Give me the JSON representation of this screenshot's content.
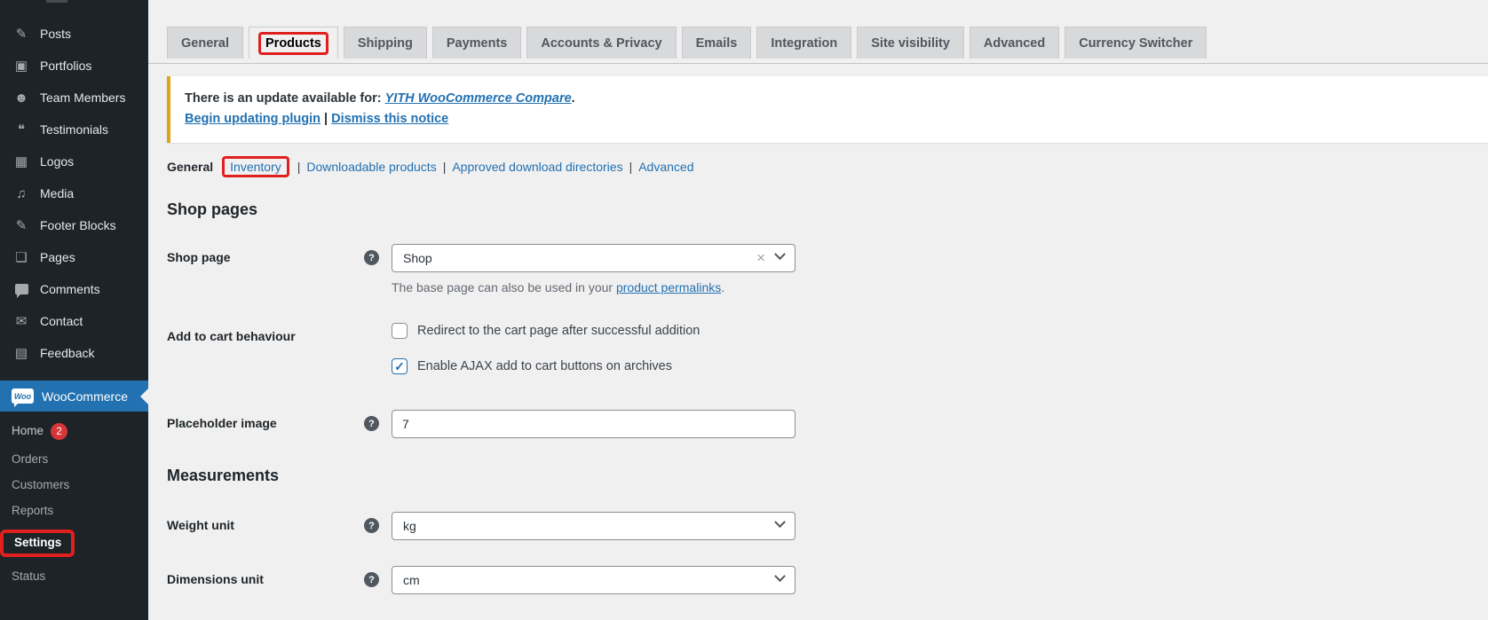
{
  "colors": {
    "accent_blue": "#2271b1",
    "sidebar_bg": "#1d2327",
    "content_bg": "#f0f0f1",
    "notice_accent": "#dba617",
    "badge_red": "#d63638",
    "annotation_red": "#e0201f"
  },
  "sidebar": {
    "items": [
      {
        "label": "Posts",
        "glyph": "✎"
      },
      {
        "label": "Portfolios",
        "glyph": "▣"
      },
      {
        "label": "Team Members",
        "glyph": "☻"
      },
      {
        "label": "Testimonials",
        "glyph": "❝"
      },
      {
        "label": "Logos",
        "glyph": "▦"
      },
      {
        "label": "Media",
        "glyph": "♫"
      },
      {
        "label": "Footer Blocks",
        "glyph": "✎"
      },
      {
        "label": "Pages",
        "glyph": "❏"
      },
      {
        "label": "Comments",
        "glyph": ""
      },
      {
        "label": "Contact",
        "glyph": "✉"
      },
      {
        "label": "Feedback",
        "glyph": "▤"
      }
    ],
    "woocommerce": {
      "label": "WooCommerce",
      "logo": "Woo"
    },
    "submenu": [
      {
        "label": "Home",
        "badge": "2"
      },
      {
        "label": "Orders"
      },
      {
        "label": "Customers"
      },
      {
        "label": "Reports"
      },
      {
        "label": "Settings"
      },
      {
        "label": "Status"
      }
    ]
  },
  "tabs": [
    "General",
    "Products",
    "Shipping",
    "Payments",
    "Accounts & Privacy",
    "Emails",
    "Integration",
    "Site visibility",
    "Advanced",
    "Currency Switcher"
  ],
  "notice": {
    "line1_before": "There is an update available for: ",
    "line1_link": "YITH WooCommerce Compare",
    "line1_after": ".",
    "action_update": "Begin updating plugin",
    "separator": "|",
    "action_dismiss": "Dismiss this notice"
  },
  "subnav": {
    "current": "General",
    "separator": "|",
    "items": [
      "Inventory",
      "Downloadable products",
      "Approved download directories",
      "Advanced"
    ]
  },
  "sections": {
    "shop_pages": "Shop pages",
    "measurements": "Measurements"
  },
  "fields": {
    "shop_page": {
      "label": "Shop page",
      "value": "Shop",
      "helper_before": "The base page can also be used in your ",
      "helper_link": "product permalinks",
      "helper_after": "."
    },
    "add_to_cart": {
      "label": "Add to cart behaviour",
      "option1": "Redirect to the cart page after successful addition",
      "option1_checked": false,
      "option2": "Enable AJAX add to cart buttons on archives",
      "option2_checked": true
    },
    "placeholder_image": {
      "label": "Placeholder image",
      "value": "7"
    },
    "weight_unit": {
      "label": "Weight unit",
      "value": "kg"
    },
    "dimensions_unit": {
      "label": "Dimensions unit",
      "value": "cm"
    }
  },
  "icons": {
    "help": "?",
    "clear": "×",
    "check": "✓"
  }
}
